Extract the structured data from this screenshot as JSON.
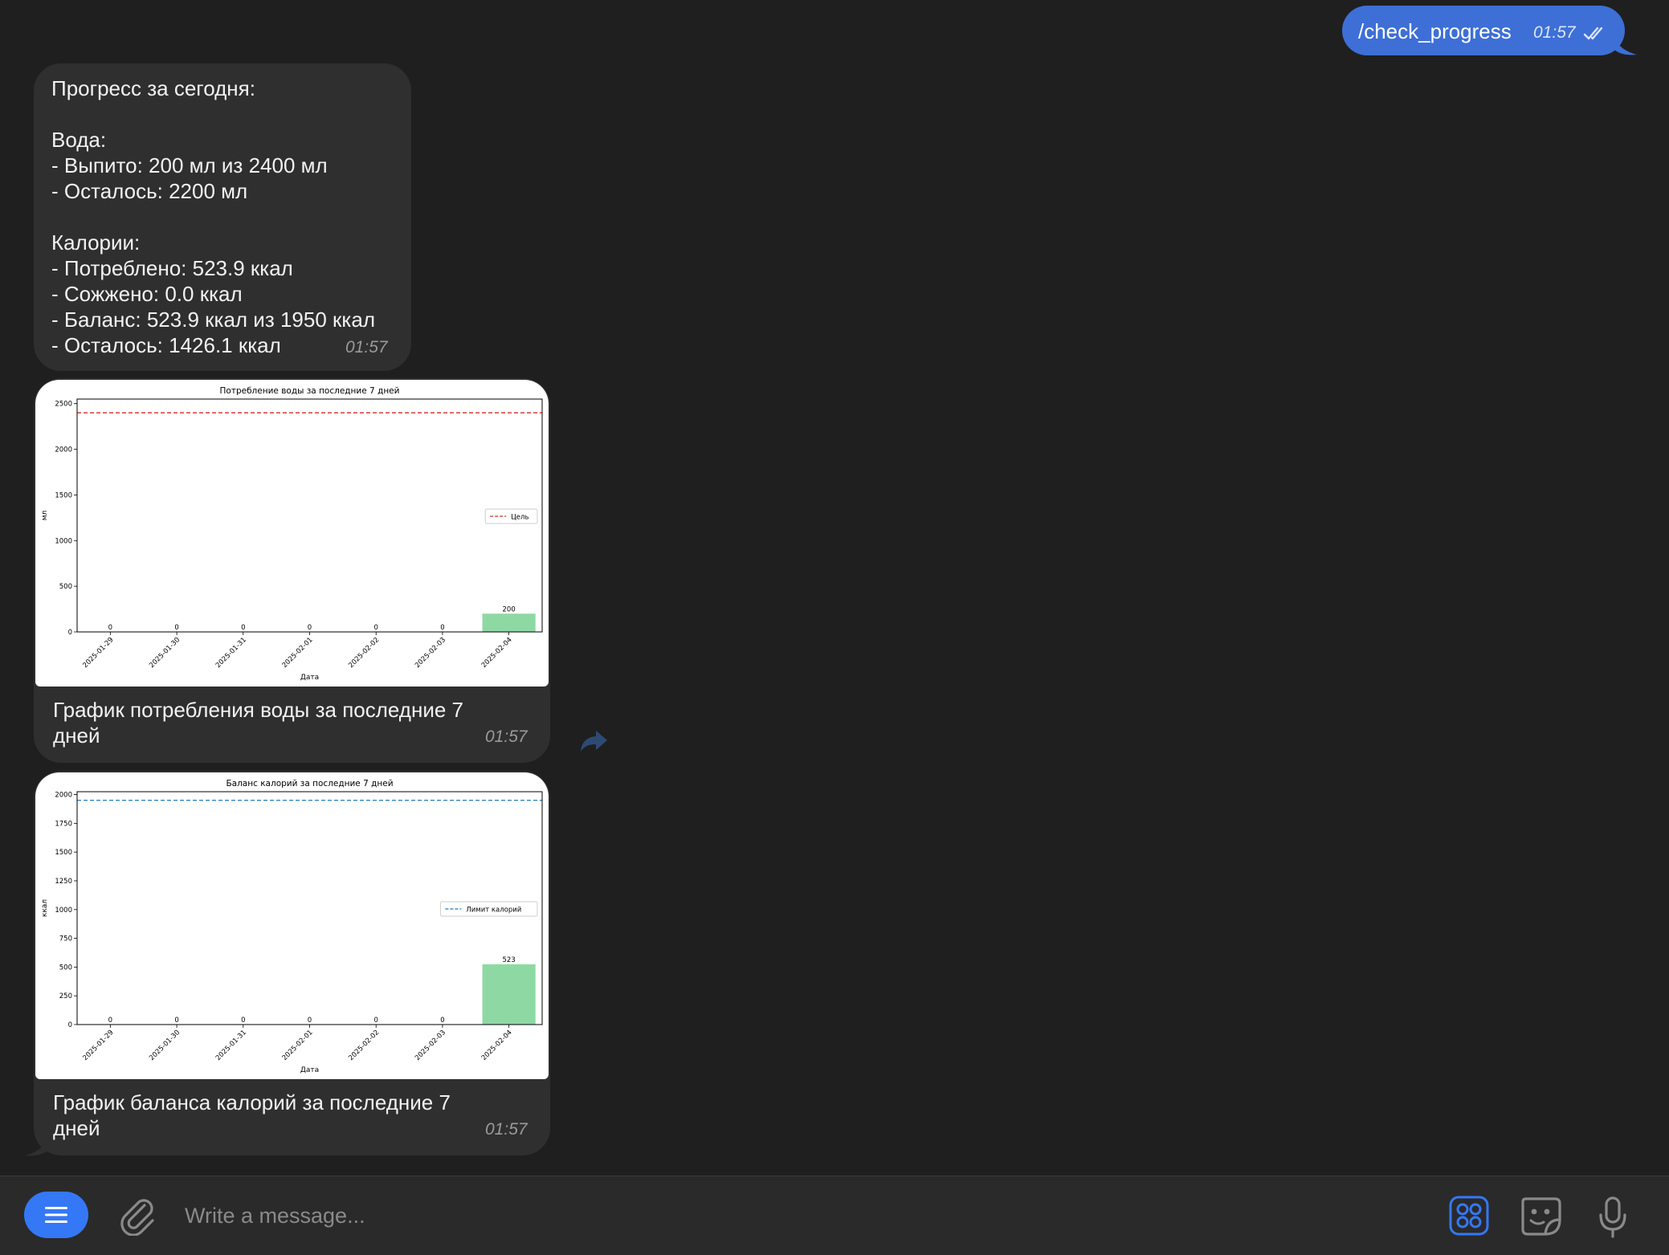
{
  "outgoing": {
    "text": "/check_progress",
    "time": "01:57"
  },
  "progress_message": {
    "lines": [
      "Прогресс за сегодня:",
      "",
      "Вода:",
      "- Выпито: 200 мл из 2400 мл",
      "- Осталось: 2200 мл",
      "",
      "Калории:",
      "- Потреблено: 523.9 ккал",
      "- Сожжено: 0.0 ккал",
      "- Баланс: 523.9 ккал из 1950 ккал",
      "- Осталось: 1426.1 ккал"
    ],
    "time": "01:57"
  },
  "photo1": {
    "caption": "График потребления воды за последние 7 дней",
    "time": "01:57"
  },
  "photo2": {
    "caption": "График баланса калорий за последние 7 дней",
    "time": "01:57"
  },
  "chart_data": [
    {
      "type": "bar",
      "title": "Потребление воды за последние 7 дней",
      "xlabel": "Дата",
      "ylabel": "мл",
      "categories": [
        "2025-01-29",
        "2025-01-30",
        "2025-01-31",
        "2025-02-01",
        "2025-02-02",
        "2025-02-03",
        "2025-02-04"
      ],
      "values": [
        0,
        0,
        0,
        0,
        0,
        0,
        200
      ],
      "data_labels": [
        "0",
        "0",
        "0",
        "0",
        "0",
        "0",
        "200"
      ],
      "ylim": [
        0,
        2550
      ],
      "yticks": [
        0,
        500,
        1000,
        1500,
        2000,
        2500
      ],
      "goal_line": {
        "name": "Цель",
        "value": 2400,
        "color": "#d62728"
      },
      "bar_color": "#8ed9a3",
      "legend_position": "center-right"
    },
    {
      "type": "bar",
      "title": "Баланс калорий за последние 7 дней",
      "xlabel": "Дата",
      "ylabel": "ккал",
      "categories": [
        "2025-01-29",
        "2025-01-30",
        "2025-01-31",
        "2025-02-01",
        "2025-02-02",
        "2025-02-03",
        "2025-02-04"
      ],
      "values": [
        0,
        0,
        0,
        0,
        0,
        0,
        523.9
      ],
      "data_labels": [
        "0",
        "0",
        "0",
        "0",
        "0",
        "0",
        "523"
      ],
      "ylim": [
        0,
        2025
      ],
      "yticks": [
        0,
        250,
        500,
        750,
        1000,
        1250,
        1500,
        1750,
        2000
      ],
      "goal_line": {
        "name": "Лимит калорий",
        "value": 1950,
        "color": "#1f77b4"
      },
      "bar_color": "#8ed9a3",
      "legend_position": "center-right"
    }
  ],
  "input": {
    "placeholder": "Write a message..."
  },
  "icons": {
    "menu": "menu-icon",
    "attach": "paperclip-icon",
    "apps": "apps-grid-icon",
    "sticker": "sticker-icon",
    "mic": "microphone-icon",
    "forward": "forward-icon",
    "read": "double-check-icon"
  },
  "colors": {
    "accent": "#3478f6",
    "outgoing_bubble": "#3d6fd6",
    "incoming_bubble": "#2f2f2f",
    "background": "#1f1f1f"
  }
}
